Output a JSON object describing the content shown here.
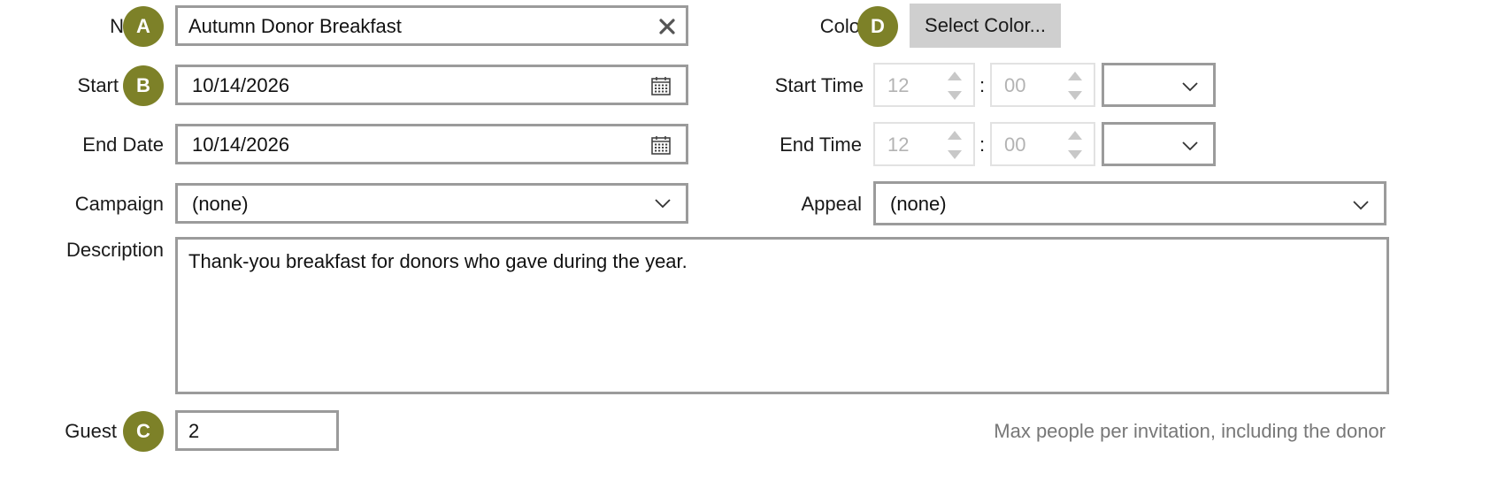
{
  "colors": {
    "badge": "#7d8128",
    "border": "#9b9b9b",
    "disabled_text": "#b3b3b3",
    "button": "#cfcfcf"
  },
  "form": {
    "name": {
      "label": "N",
      "value": "Autumn Donor Breakfast",
      "clear_icon": "close-icon"
    },
    "start_date": {
      "label": "Start",
      "value": "10/14/2026",
      "icon": "calendar-icon"
    },
    "end_date": {
      "label": "End Date",
      "value": "10/14/2026",
      "icon": "calendar-icon"
    },
    "campaign": {
      "label": "Campaign",
      "value": "(none)"
    },
    "description": {
      "label": "Description",
      "value": "Thank-you breakfast for donors who gave during the year."
    },
    "guest": {
      "label": "Guest",
      "value": "2",
      "hint": "Max people per invitation, including the donor"
    },
    "color": {
      "label": "Colo",
      "button": "Select Color..."
    },
    "start_time": {
      "label": "Start Time",
      "hour": "12",
      "minute": "00",
      "separator": ":",
      "ampm": ""
    },
    "end_time": {
      "label": "End Time",
      "hour": "12",
      "minute": "00",
      "separator": ":",
      "ampm": ""
    },
    "appeal": {
      "label": "Appeal",
      "value": "(none)"
    }
  },
  "badges": {
    "a": "A",
    "b": "B",
    "c": "C",
    "d": "D"
  }
}
